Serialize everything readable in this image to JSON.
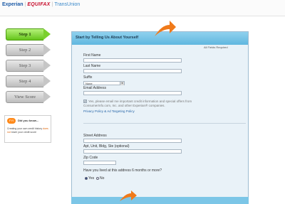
{
  "brands": {
    "experian": "Experian",
    "equifax": "EQUIFAX",
    "transunion": "TransUnion"
  },
  "steps": [
    {
      "label": "Step 1",
      "active": true
    },
    {
      "label": "Step 2",
      "active": false
    },
    {
      "label": "Step 3",
      "active": false
    },
    {
      "label": "Step 4",
      "active": false
    },
    {
      "label": "View Score",
      "active": false
    }
  ],
  "did_you_know": {
    "badge": "FYI",
    "title": "Did you know...",
    "text_before": "Creating your own credit history ",
    "link": "does not",
    "text_after": " lower your credit score"
  },
  "form": {
    "header_title": "Start by Telling Us About Yourself",
    "required_note": "All Fields Required",
    "first_name_label": "First Name",
    "last_name_label": "Last Name",
    "suffix_label": "Suffix",
    "suffix_value": "None",
    "email_label": "Email Address",
    "consent_text": "Yes, please email me important credit information and special offers from ConsumerInfo.com, Inc. and other Experian® companies.",
    "privacy_link": "Privacy Policy & Ad Targeting Policy",
    "street_label": "Street Address",
    "apt_label": "Apt, Unit, Bldg, Ste (optional)",
    "zip_label": "Zip Code",
    "residence_question": "Have you lived at this address 6 months or more?",
    "radio_yes": "Yes",
    "radio_no": "No"
  },
  "colors": {
    "accent_orange": "#f07a1a",
    "header_blue": "#6cc0e5",
    "active_step_green": "#7bd02d"
  }
}
